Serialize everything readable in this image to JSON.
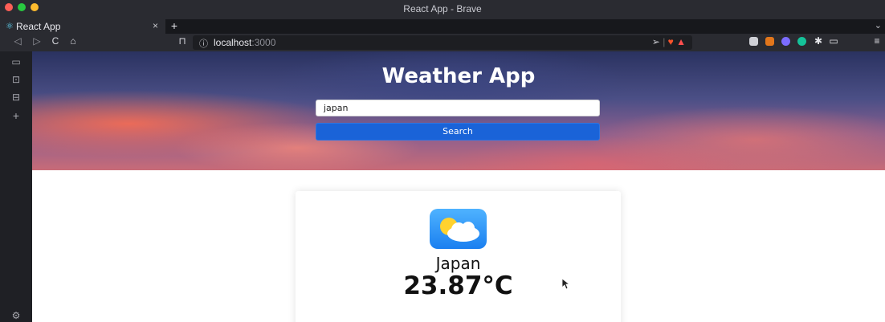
{
  "window": {
    "title": "React App - Brave"
  },
  "tabs": [
    {
      "label": "React App"
    }
  ],
  "toolbar": {
    "url_host": "localhost",
    "url_port": ":3000"
  },
  "page": {
    "title": "Weather App",
    "search": {
      "value": "japan"
    },
    "search_button": "Search",
    "result": {
      "city": "Japan",
      "temperature": "23.87°C",
      "icon": "partly-cloudy-icon"
    }
  },
  "colors": {
    "primary_button": "#1a63d8",
    "tab_react_icon": "#61dafb"
  }
}
